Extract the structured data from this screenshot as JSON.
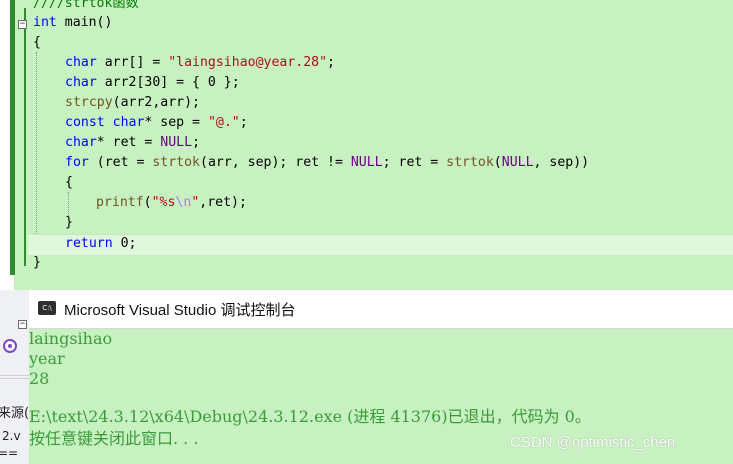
{
  "editor": {
    "lines": [
      "////strtok函数",
      "int main()",
      "{",
      "char arr[] = \"laingsihao@year.28\";",
      "char arr2[30] = { 0 };",
      "strcpy(arr2,arr);",
      "const char* sep = \"@.\";",
      "char* ret = NULL;",
      "for (ret = strtok(arr, sep); ret != NULL; ret = strtok(NULL, sep))",
      "{",
      "printf(\"%s\\n\",ret);",
      "}",
      "return 0;",
      "}"
    ]
  },
  "console": {
    "title": "Microsoft Visual Studio 调试控制台",
    "icon": "console-app-icon",
    "output": [
      "laingsihao",
      "year",
      "28",
      "",
      "E:\\text\\24.3.12\\x64\\Debug\\24.3.12.exe (进程 41376)已退出，代码为 0。",
      "按任意键关闭此窗口. . ."
    ]
  },
  "ide_strip": {
    "items": [
      "来源(",
      "2.v",
      "== "
    ]
  },
  "watermark": "CSDN @optimistic_chen",
  "colors": {
    "editor_bg": "#c7f1c0",
    "console_text": "#3b9b3b",
    "keyword": "#0000ff",
    "string": "#a31515",
    "comment": "#008000",
    "macro": "#6f008a"
  }
}
